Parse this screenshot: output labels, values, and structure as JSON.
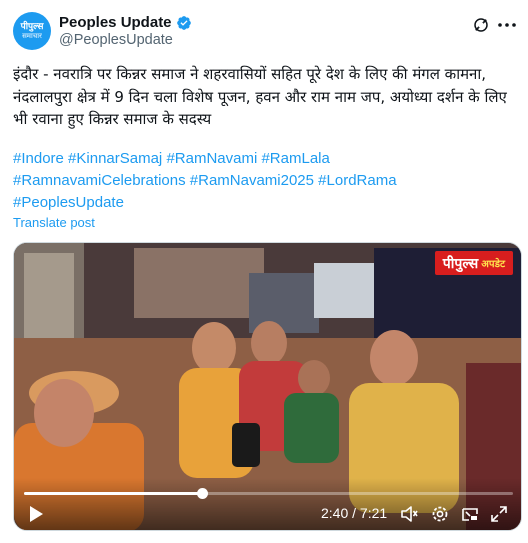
{
  "author": {
    "display_name": "Peoples Update",
    "handle": "@PeoplesUpdate",
    "avatar_text_line1": "पीपुल्स",
    "avatar_text_line2": "समाचार",
    "verified_icon": "verified-badge-icon"
  },
  "header_icons": [
    "grok-icon",
    "more-icon"
  ],
  "tweet": {
    "text": "इंदौर - नवरात्रि पर किन्नर समाज ने शहरवासियों सहित पूरे देश के लिए की मंगल कामना, नंदलालपुरा क्षेत्र में 9 दिन चला विशेष पूजन, हवन और राम नाम जप, अयोध्या दर्शन के लिए भी रवाना हुए किन्नर समाज के सदस्य",
    "hashtags_line1": [
      "#Indore",
      "#KinnarSamaj",
      "#RamNavami",
      "#RamLala"
    ],
    "hashtags_line2": [
      "#RamnavamiCelebrations",
      "#RamNavami2025",
      "#LordRama"
    ],
    "hashtags_line3": [
      "#PeoplesUpdate"
    ],
    "translate_label": "Translate post"
  },
  "video": {
    "watermark_main": "पीपुल्स",
    "watermark_sub": "अपडेट",
    "current_time": "2:40",
    "duration": "7:21",
    "time_display": "2:40 / 7:21",
    "progress_fraction": 0.363,
    "control_icons": [
      "play-icon",
      "volume-icon",
      "settings-icon",
      "pip-icon",
      "fullscreen-icon"
    ]
  },
  "colors": {
    "accent": "#1d9bf0",
    "text": "#0f1419",
    "secondary": "#536471",
    "brand_red": "#d81e1e"
  }
}
